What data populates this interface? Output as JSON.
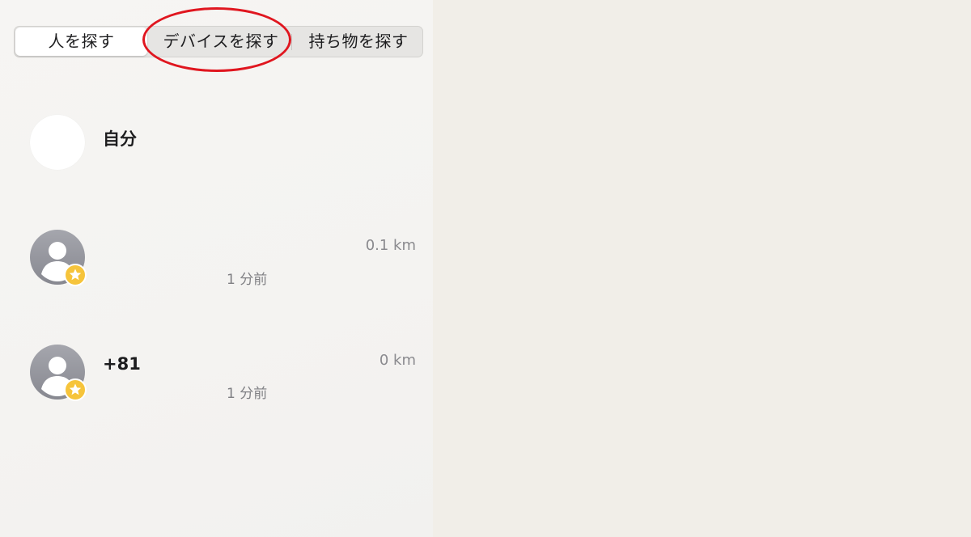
{
  "tabs": [
    {
      "label": "人を探す",
      "selected": true
    },
    {
      "label": "デバイスを探す",
      "selected": false
    },
    {
      "label": "持ち物を探す",
      "selected": false
    }
  ],
  "highlight_color": "#e0161f",
  "me": {
    "name": "自分"
  },
  "people": [
    {
      "name": "",
      "distance": "0.1 km",
      "time": "1 分前",
      "avatar_icon": "person-placeholder-icon",
      "badge_icon": "star-icon"
    },
    {
      "name": "+81",
      "distance": "0 km",
      "time": "1 分前",
      "avatar_icon": "person-placeholder-icon",
      "badge_icon": "star-icon"
    }
  ]
}
